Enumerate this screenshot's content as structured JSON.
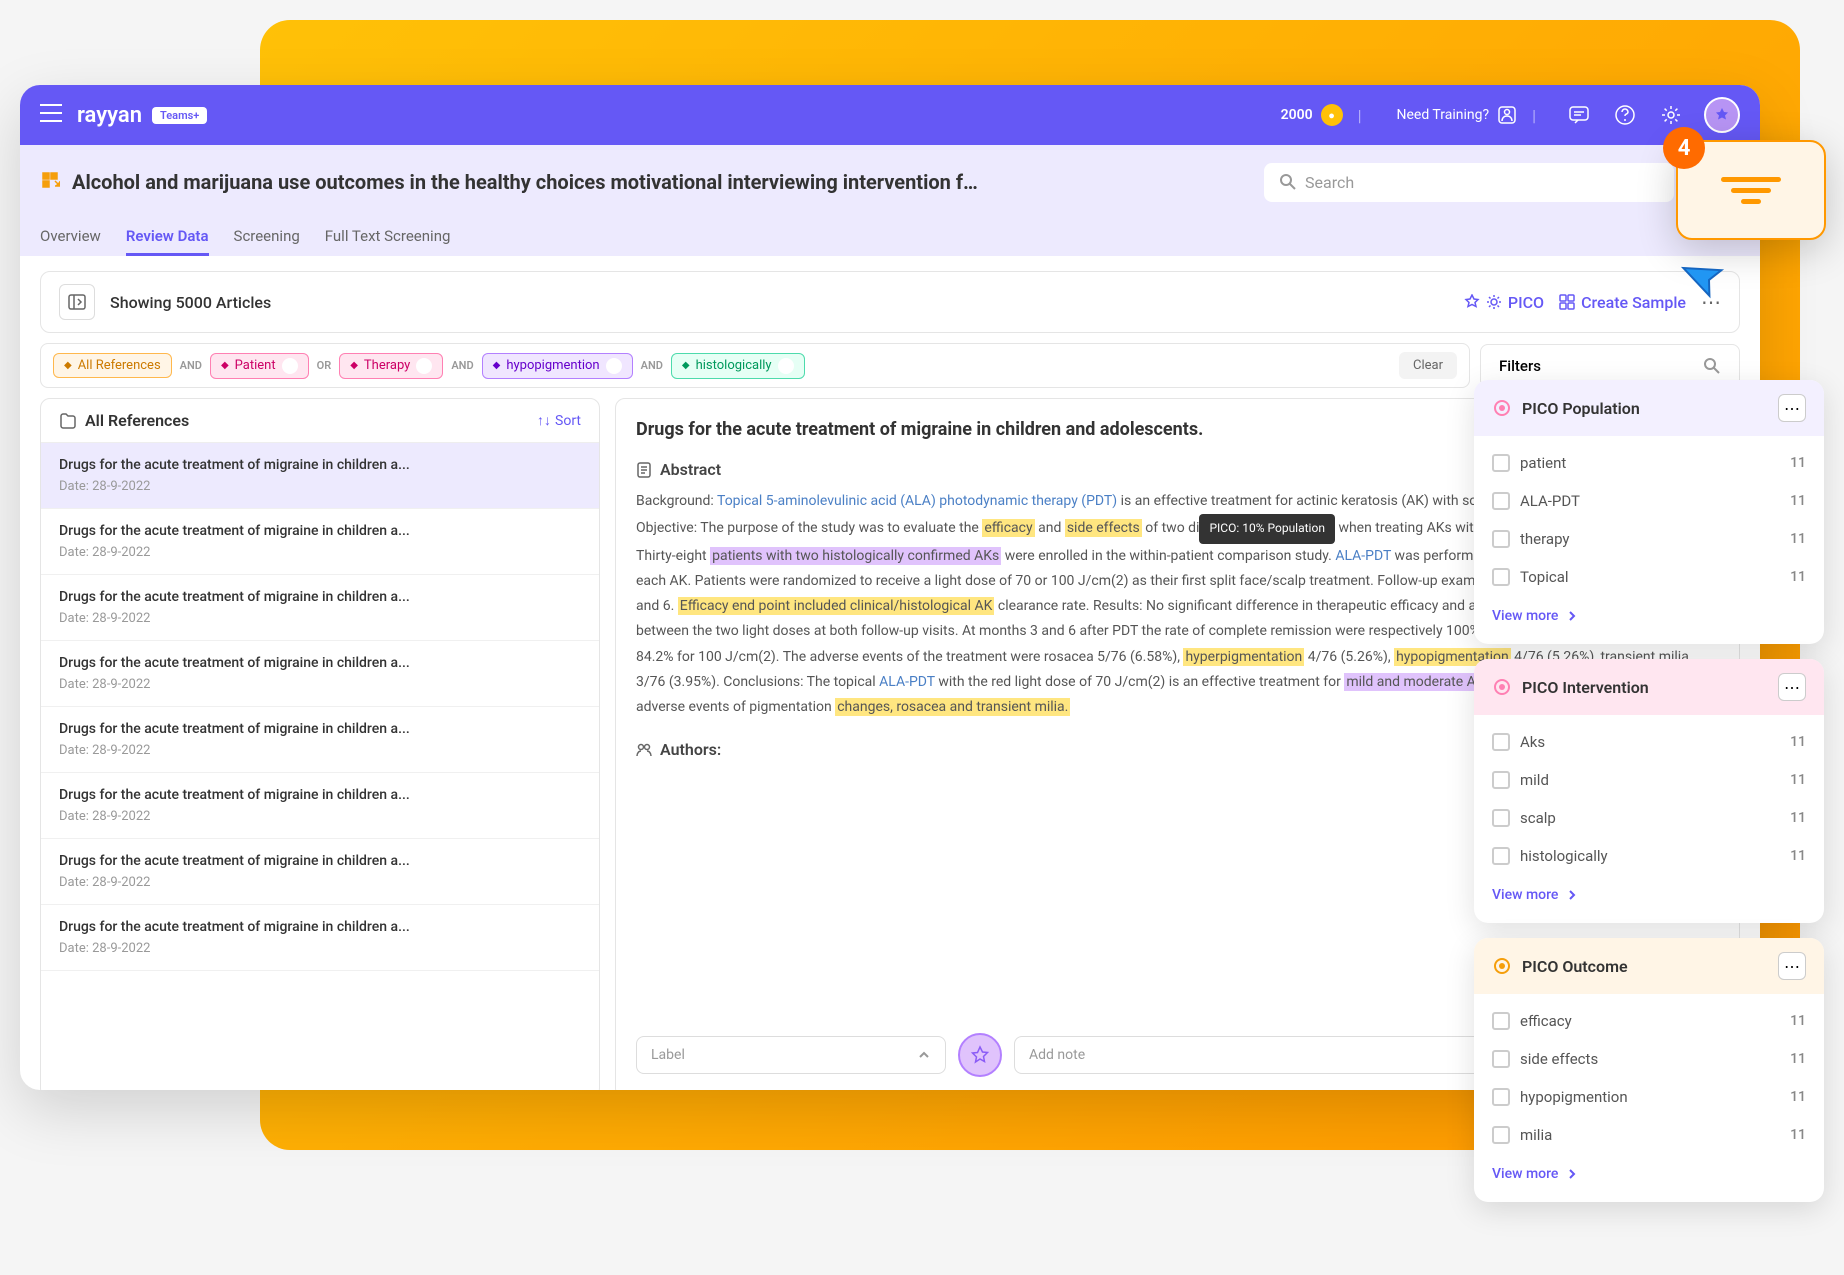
{
  "header": {
    "logo": "rayyan",
    "teams_badge": "Teams+",
    "credits": "2000",
    "training_label": "Need Training?"
  },
  "page": {
    "title": "Alcohol and marijuana use outcomes in the healthy choices motivational interviewing intervention f…",
    "search_placeholder": "Search",
    "tabs": [
      "Overview",
      "Review Data",
      "Screening",
      "Full Text Screening"
    ],
    "active_tab": 1
  },
  "toolbar": {
    "showing": "Showing 5000 Articles",
    "pico": "PICO",
    "create_sample": "Create Sample"
  },
  "filter_chips": {
    "items": [
      {
        "label": "All References",
        "color": "orange",
        "closable": false
      },
      {
        "op": "AND"
      },
      {
        "label": "Patient",
        "color": "pink",
        "closable": true
      },
      {
        "op": "OR"
      },
      {
        "label": "Therapy",
        "color": "pink",
        "closable": true
      },
      {
        "op": "AND"
      },
      {
        "label": "hypopigmention",
        "color": "purple",
        "closable": true
      },
      {
        "op": "AND"
      },
      {
        "label": "histologically",
        "color": "teal",
        "closable": true
      }
    ],
    "clear": "Clear",
    "filters_label": "Filters"
  },
  "article_list": {
    "header": "All References",
    "sort": "Sort",
    "articles": [
      {
        "title": "Drugs for the acute treatment of migraine in children a...",
        "date": "Date: 28-9-2022",
        "selected": true
      },
      {
        "title": "Drugs for the acute treatment of migraine in children a...",
        "date": "Date: 28-9-2022"
      },
      {
        "title": "Drugs for the acute treatment of migraine in children a...",
        "date": "Date: 28-9-2022"
      },
      {
        "title": "Drugs for the acute treatment of migraine in children a...",
        "date": "Date: 28-9-2022"
      },
      {
        "title": "Drugs for the acute treatment of migraine in children a...",
        "date": "Date: 28-9-2022"
      },
      {
        "title": "Drugs for the acute treatment of migraine in children a...",
        "date": "Date: 28-9-2022"
      },
      {
        "title": "Drugs for the acute treatment of migraine in children a...",
        "date": "Date: 28-9-2022"
      },
      {
        "title": "Drugs for the acute treatment of migraine in children a...",
        "date": "Date: 28-9-2022"
      }
    ]
  },
  "detail": {
    "title": "Drugs for the acute treatment of migraine in children and adolescents.",
    "abstract_label": "Abstract",
    "authors_label": "Authors:",
    "tooltip": "PICO: 10% Population",
    "abstract_segments": [
      {
        "t": "Background: "
      },
      {
        "t": "Topical 5-aminolevulinic acid (ALA) photodynamic therapy (PDT)",
        "c": "hl-blue"
      },
      {
        "t": " is an effective treatment for actinic keratosis (AK) with some transient adverse events. Objective: The purpose of the study was to evaluate the "
      },
      {
        "t": "efficacy",
        "c": "hl-yellow"
      },
      {
        "t": " and "
      },
      {
        "t": "side effects",
        "c": "hl-yellow"
      },
      {
        "t": " of two di"
      },
      {
        "tooltip": true
      },
      {
        "t": "when treating AKs with "
      },
      {
        "t": "ALA-PDT",
        "c": "hl-blue"
      },
      {
        "t": " on the face/scalp. Methods: Thirty-eight "
      },
      {
        "t": "patients with two histologically confirmed AKs",
        "c": "hl-purple"
      },
      {
        "t": " were enrolled in the within-patient comparison study. "
      },
      {
        "t": "ALA-PDT",
        "c": "hl-blue"
      },
      {
        "t": " was performed twice with two weeks interval for each AK. Patients were randomized to receive a light dose of 70 or 100 J/cm(2) as their first split face/scalp treatment. Follow-up examinations were carried out at months 3 and 6. "
      },
      {
        "t": "Efficacy end point included clinical/histological AK",
        "c": "hl-yellow"
      },
      {
        "t": " clearance rate. Results: No significant difference in therapeutic efficacy and adverse events of "
      },
      {
        "t": "ALA-PDT",
        "c": "hl-blue"
      },
      {
        "t": " was found between the two light doses at both follow-up visits. At months 3 and 6 after PDT the rate of complete remission were respectively 100% and 92.1% for 70 J/cm(2), 92.1% and 84.2% for 100 J/cm(2). The adverse events of the treatment were rosacea 5/76 (6.58%), "
      },
      {
        "t": "hyperpigmentation",
        "c": "hl-yellow"
      },
      {
        "t": " 4/76 (5.26%), "
      },
      {
        "t": "hypopigmentation",
        "c": "hl-yellow"
      },
      {
        "t": " 4/76 (5.26%), transient milia 3/76 (3.95%). Conclusions: The topical "
      },
      {
        "t": "ALA-PDT",
        "c": "hl-blue"
      },
      {
        "t": " with the red light dose of 70 J/cm(2) is an effective treatment for "
      },
      {
        "t": "mild and moderate AKs on the face/scalp",
        "c": "hl-purple"
      },
      {
        "t": " with expected adverse events of pigmentation "
      },
      {
        "t": "changes, rosacea and transient milia.",
        "c": "hl-yellow"
      }
    ],
    "label_placeholder": "Label",
    "note_placeholder": "Add note"
  },
  "callout_badge": "4",
  "filter_cards": [
    {
      "icon_color": "#ff80b3",
      "title": "PICO Population",
      "items": [
        {
          "label": "patient",
          "count": "11"
        },
        {
          "label": "ALA-PDT",
          "count": "11"
        },
        {
          "label": "therapy",
          "count": "11"
        },
        {
          "label": "Topical",
          "count": "11"
        }
      ],
      "view_more": "View more"
    },
    {
      "icon_color": "#ff80b3",
      "title": "PICO Intervention",
      "header_bg": "#ffe6f0",
      "items": [
        {
          "label": "Aks",
          "count": "11"
        },
        {
          "label": "mild",
          "count": "11"
        },
        {
          "label": "scalp",
          "count": "11"
        },
        {
          "label": "histologically",
          "count": "11"
        }
      ],
      "view_more": "View more"
    },
    {
      "icon_color": "#f59e0b",
      "title": "PICO Outcome",
      "header_bg": "#fff5e6",
      "items": [
        {
          "label": "efficacy",
          "count": "11"
        },
        {
          "label": "side effects",
          "count": "11"
        },
        {
          "label": "hypopigmention",
          "count": "11"
        },
        {
          "label": "milia",
          "count": "11"
        }
      ],
      "view_more": "View more"
    }
  ]
}
